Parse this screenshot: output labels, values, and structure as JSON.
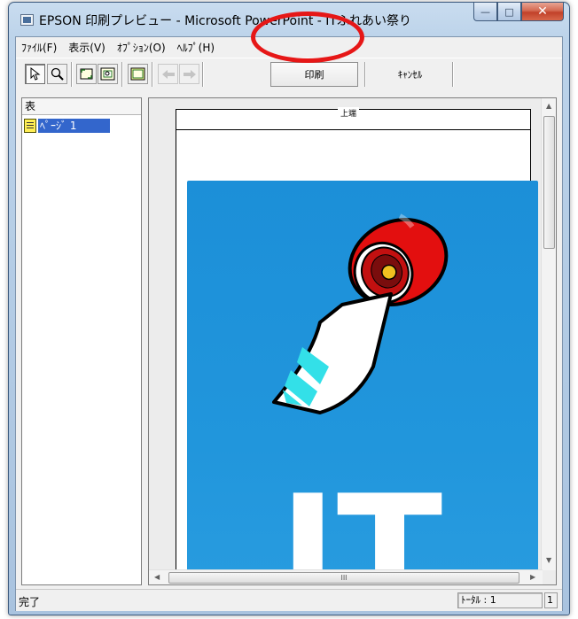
{
  "window": {
    "title": "EPSON 印刷プレビュー - Microsoft PowerPoint - ITふれあい祭り",
    "caption_buttons": {
      "minimize": "—",
      "maximize": "□",
      "close": "✕"
    }
  },
  "menu": [
    "ﾌｧｲﾙ(F)",
    "表示(V)",
    "ｵﾌﾟｼｮﾝ(O)",
    "ﾍﾙﾌﾟ(H)"
  ],
  "toolbar": {
    "print_label": "印刷",
    "cancel_label": "ｷｬﾝｾﾙ"
  },
  "left_pane": {
    "header": "表",
    "page_item": "ﾍﾟｰｼﾞ 1"
  },
  "preview": {
    "header_label": "上端",
    "slide_text": "IT",
    "hscroll_grip": "III"
  },
  "status": {
    "text": "完了",
    "total": "ﾄｰﾀﾙ : 1",
    "page": "1"
  },
  "colors": {
    "slide_background": "#1c8fd8",
    "highlight_circle": "#e61717",
    "selection": "#3366cc"
  }
}
